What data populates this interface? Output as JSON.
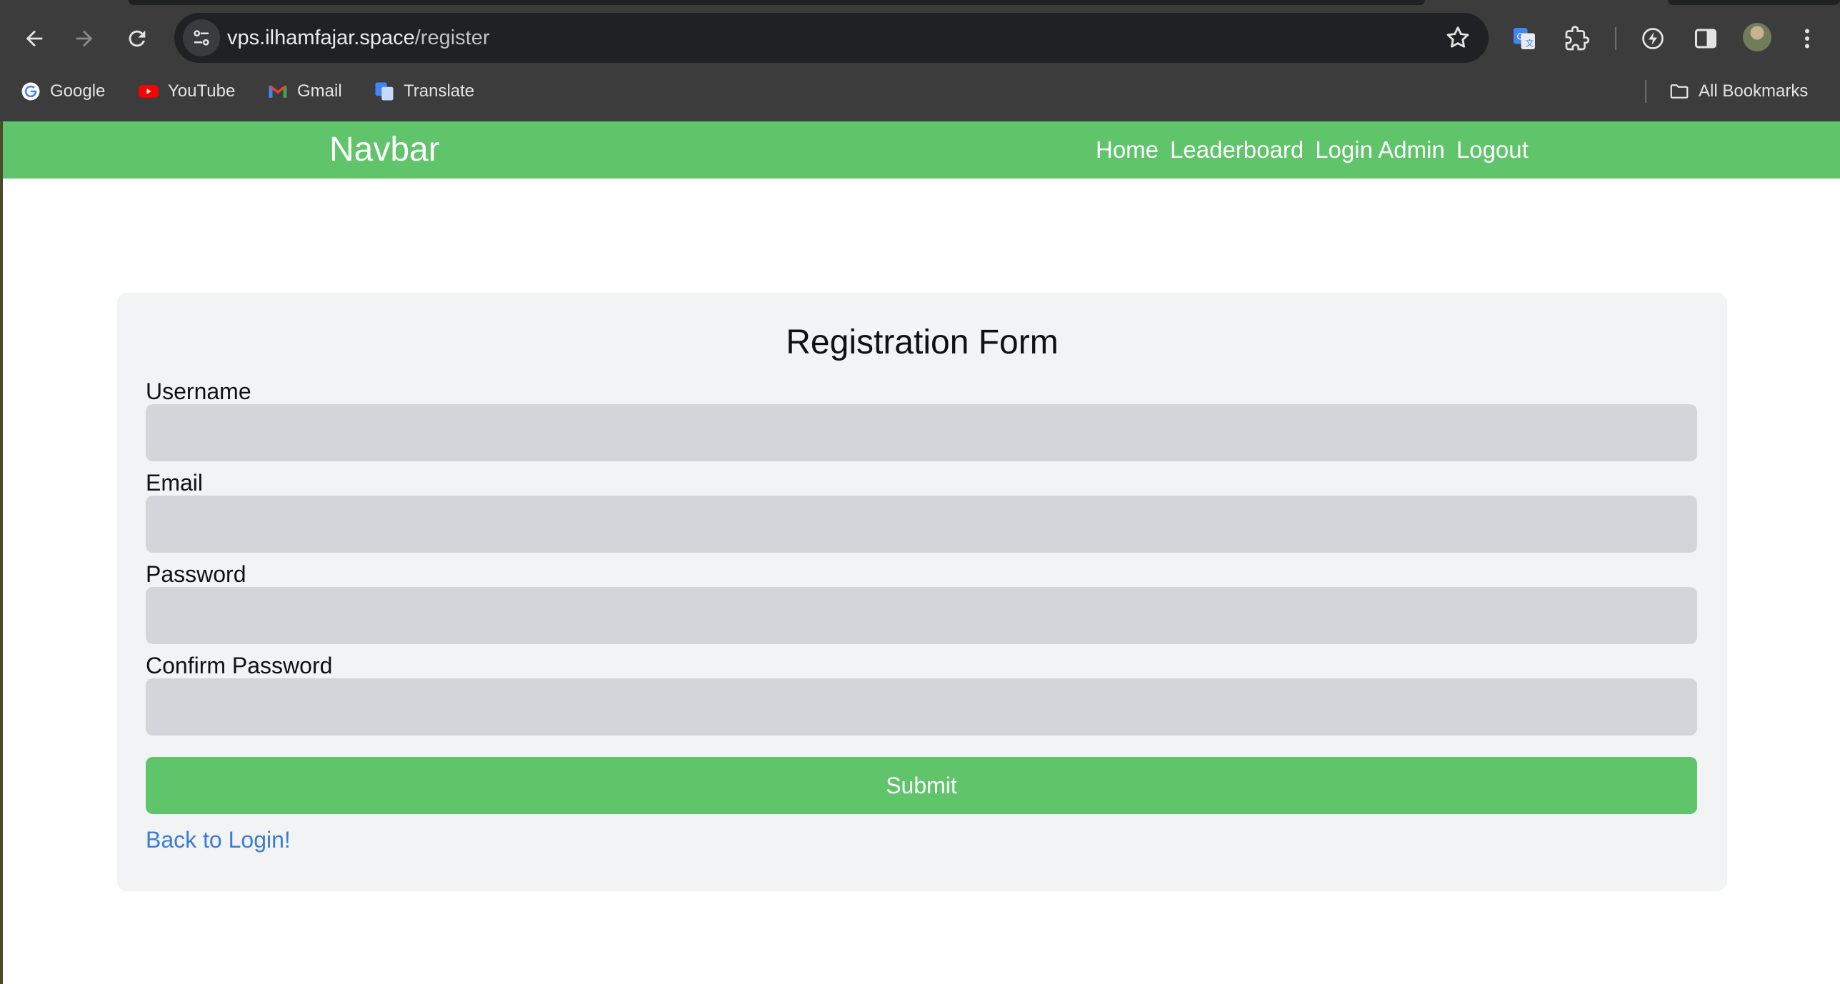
{
  "browser": {
    "url_host": "vps.ilhamfajar.space",
    "url_path": "/register",
    "bookmarks": [
      {
        "label": "Google",
        "icon": "google-icon"
      },
      {
        "label": "YouTube",
        "icon": "youtube-icon"
      },
      {
        "label": "Gmail",
        "icon": "gmail-icon"
      },
      {
        "label": "Translate",
        "icon": "translate-icon"
      }
    ],
    "all_bookmarks": "All Bookmarks"
  },
  "navbar": {
    "brand": "Navbar",
    "links": [
      "Home",
      "Leaderboard",
      "Login Admin",
      "Logout"
    ],
    "color": "#5fc46a"
  },
  "form": {
    "title": "Registration Form",
    "fields": [
      {
        "label": "Username",
        "value": ""
      },
      {
        "label": "Email",
        "value": ""
      },
      {
        "label": "Password",
        "value": ""
      },
      {
        "label": "Confirm Password",
        "value": ""
      }
    ],
    "submit_label": "Submit",
    "back_link": "Back to Login!"
  },
  "colors": {
    "accent": "#5fc46a",
    "link": "#3b7bd8",
    "card_bg": "#f2f3f5",
    "input_bg": "#d2d5da"
  }
}
